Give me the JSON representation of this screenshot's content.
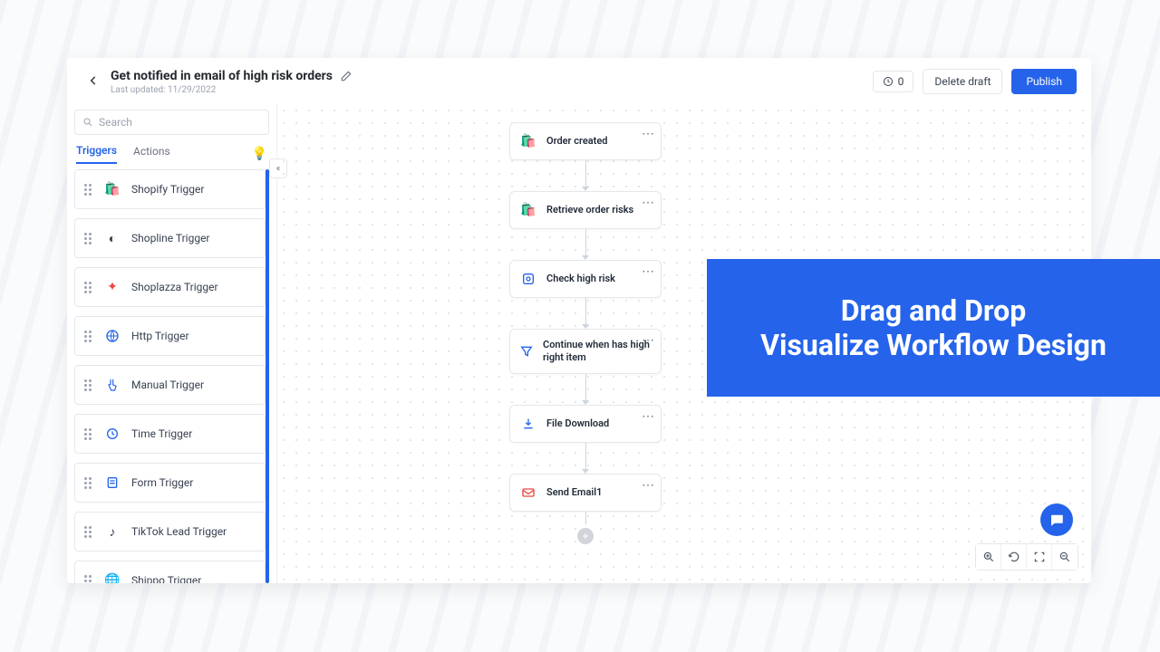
{
  "header": {
    "title": "Get notified in email of high risk orders",
    "last_updated_label": "Last updated: 11/29/2022",
    "counter": "0",
    "delete_label": "Delete draft",
    "publish_label": "Publish"
  },
  "sidebar": {
    "search_placeholder": "Search",
    "tab_triggers": "Triggers",
    "tab_actions": "Actions",
    "items": [
      {
        "label": "Shopify Trigger"
      },
      {
        "label": "Shopline Trigger"
      },
      {
        "label": "Shoplazza Trigger"
      },
      {
        "label": "Http Trigger"
      },
      {
        "label": "Manual Trigger"
      },
      {
        "label": "Time Trigger"
      },
      {
        "label": "Form Trigger"
      },
      {
        "label": "TikTok Lead Trigger"
      },
      {
        "label": "Shippo Trigger"
      }
    ]
  },
  "flow": {
    "nodes": [
      {
        "label": "Order created"
      },
      {
        "label": "Retrieve order risks"
      },
      {
        "label": "Check high risk"
      },
      {
        "label": "Continue when has high right item"
      },
      {
        "label": "File Download"
      },
      {
        "label": "Send Email1"
      }
    ]
  },
  "promo": {
    "line1": "Drag and Drop",
    "line2": "Visualize Workflow Design"
  }
}
